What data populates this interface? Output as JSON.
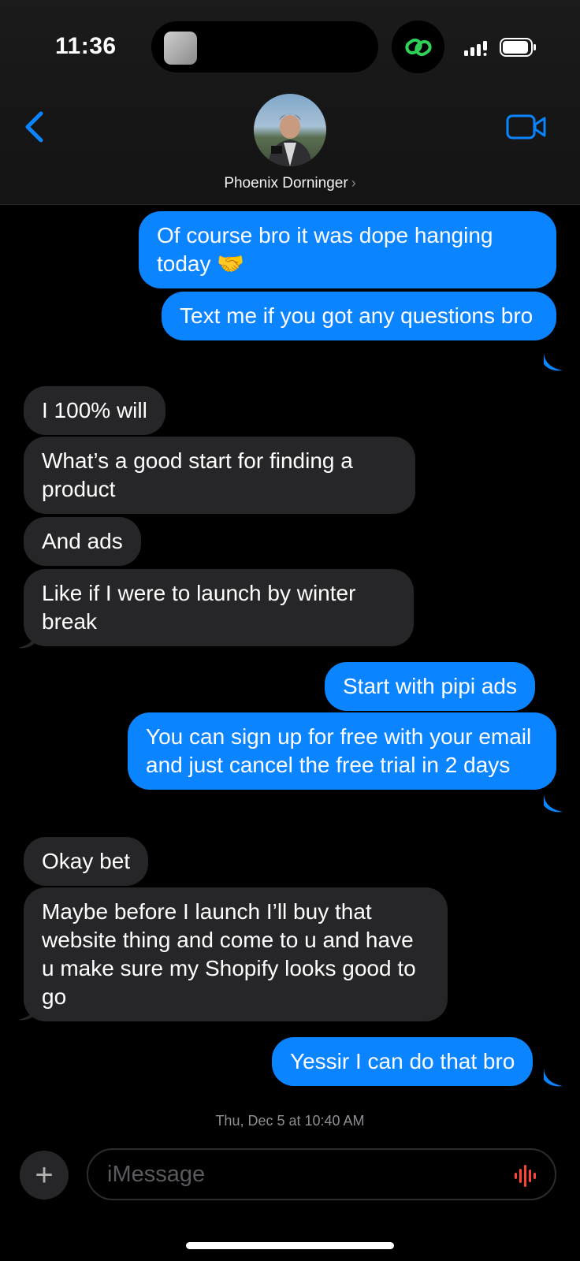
{
  "status": {
    "time": "11:36"
  },
  "header": {
    "contact_name": "Phoenix Dorninger",
    "name_chevron": "›"
  },
  "messages": [
    {
      "side": "sent",
      "text": "Of course bro it was dope hanging today 🤝"
    },
    {
      "side": "sent",
      "text": "Text me if you got any questions bro"
    },
    {
      "side": "received",
      "text": "I 100% will"
    },
    {
      "side": "received",
      "text": "What’s a good start for finding a product"
    },
    {
      "side": "received",
      "text": "And ads"
    },
    {
      "side": "received",
      "text": "Like if I were to launch by winter break"
    },
    {
      "side": "sent",
      "text": "Start with pipi ads"
    },
    {
      "side": "sent",
      "text": "You can sign up for free with your email and just cancel the free trial in 2 days"
    },
    {
      "side": "received",
      "text": "Okay bet"
    },
    {
      "side": "received",
      "text": "Maybe before I launch I’ll buy that website thing and come to u and have u make sure my Shopify looks good to go"
    },
    {
      "side": "sent",
      "text": "Yessir I can do that bro"
    }
  ],
  "timestamp": "Thu, Dec 5 at 10:40 AM",
  "input": {
    "placeholder": "iMessage",
    "plus_label": "+"
  },
  "colors": {
    "sent_bubble": "#0a84ff",
    "received_bubble": "#262628",
    "accent": "#0a84ff",
    "link_icon": "#30d158",
    "audio_icon": "#ff453a"
  }
}
